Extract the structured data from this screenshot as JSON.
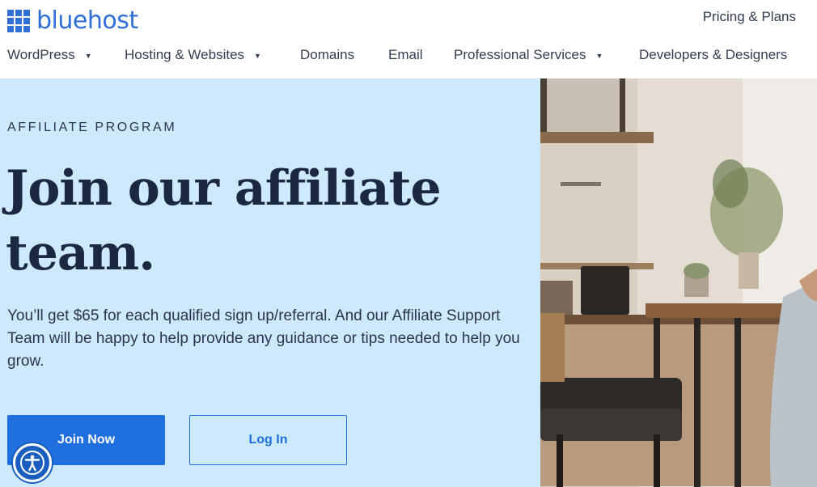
{
  "brand": {
    "name": "bluehost",
    "color": "#2f6fd6"
  },
  "header": {
    "top_link": "Pricing & Plans",
    "nav": [
      {
        "label": "WordPress",
        "has_dropdown": true
      },
      {
        "label": "Hosting & Websites",
        "has_dropdown": true
      },
      {
        "label": "Domains",
        "has_dropdown": false
      },
      {
        "label": "Email",
        "has_dropdown": false
      },
      {
        "label": "Professional Services",
        "has_dropdown": true
      },
      {
        "label": "Developers & Designers",
        "has_dropdown": false
      }
    ]
  },
  "hero": {
    "eyebrow": "AFFILIATE PROGRAM",
    "headline_line1": "Join our affiliate",
    "headline_line2": "team.",
    "description": "You’ll get $65 for each qualified sign up/referral. And our Affiliate Support Team will be happy to help provide any guidance or tips needed to help you grow.",
    "primary_button": "Join Now",
    "secondary_button": "Log In",
    "background_color": "#cdeafd",
    "accent_color": "#1f6fde"
  },
  "accessibility": {
    "icon": "accessibility-icon"
  },
  "photo": {
    "icon": "office-interior-photo"
  }
}
